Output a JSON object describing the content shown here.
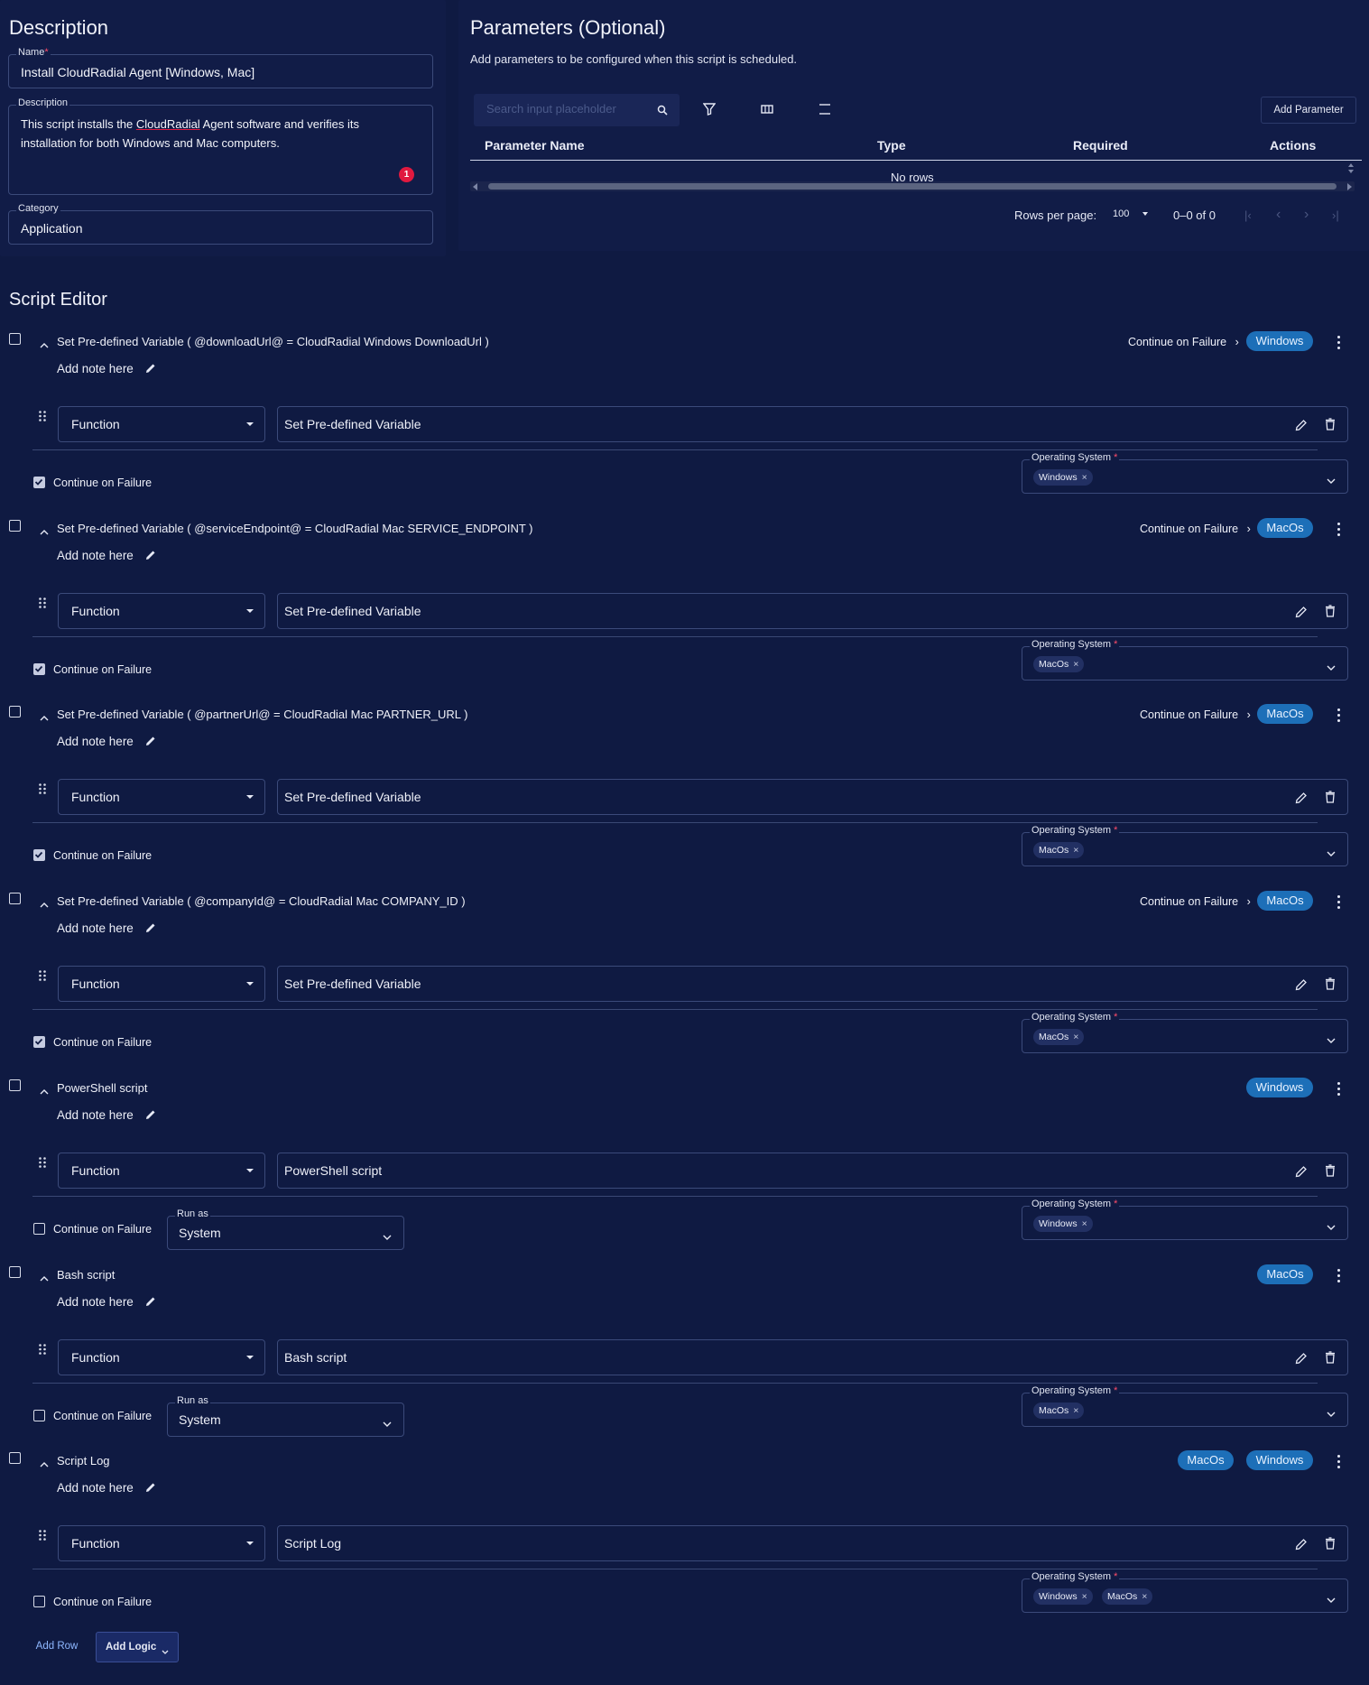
{
  "description_panel": {
    "title": "Description",
    "name_label": "Name",
    "name_value": "Install CloudRadial Agent [Windows, Mac]",
    "description_label": "Description",
    "description_value_pre": "This script installs the ",
    "description_value_link": "CloudRadial",
    "description_value_post": " Agent software and verifies its installation for both Windows and Mac computers.",
    "error_count": "1",
    "category_label": "Category",
    "category_value": "Application"
  },
  "parameters_panel": {
    "title": "Parameters (Optional)",
    "subtitle": "Add parameters to be configured when this script is scheduled.",
    "search_placeholder": "Search input placeholder",
    "add_parameter_label": "Add Parameter",
    "columns": [
      "Parameter Name",
      "Type",
      "Required",
      "Actions"
    ],
    "empty_text": "No rows",
    "rows_per_page_label": "Rows per page:",
    "rows_per_page_value": "100",
    "range_text": "0–0 of 0"
  },
  "script_editor": {
    "title": "Script Editor",
    "note_label": "Add note here",
    "function_label": "Function",
    "cof_label": "Continue on Failure",
    "os_label": "Operating System",
    "run_as_label": "Run as",
    "steps": [
      {
        "title": "Set Pre-defined Variable ( @downloadUrl@ = CloudRadial Windows DownloadUrl )",
        "header_cof": "Continue on Failure",
        "chips": [
          "Windows"
        ],
        "value": "Set Pre-defined Variable",
        "os": [
          "Windows"
        ],
        "cof_checked": true,
        "run_as": null
      },
      {
        "title": "Set Pre-defined Variable ( @serviceEndpoint@ = CloudRadial Mac SERVICE_ENDPOINT )",
        "header_cof": "Continue on Failure",
        "chips": [
          "MacOs"
        ],
        "value": "Set Pre-defined Variable",
        "os": [
          "MacOs"
        ],
        "cof_checked": true,
        "run_as": null
      },
      {
        "title": "Set Pre-defined Variable ( @partnerUrl@ = CloudRadial Mac PARTNER_URL )",
        "header_cof": "Continue on Failure",
        "chips": [
          "MacOs"
        ],
        "value": "Set Pre-defined Variable",
        "os": [
          "MacOs"
        ],
        "cof_checked": true,
        "run_as": null
      },
      {
        "title": "Set Pre-defined Variable ( @companyId@ = CloudRadial Mac COMPANY_ID )",
        "header_cof": "Continue on Failure",
        "chips": [
          "MacOs"
        ],
        "value": "Set Pre-defined Variable",
        "os": [
          "MacOs"
        ],
        "cof_checked": true,
        "run_as": null
      },
      {
        "title": "PowerShell script",
        "header_cof": "",
        "chips": [
          "Windows"
        ],
        "value": "PowerShell script",
        "os": [
          "Windows"
        ],
        "cof_checked": false,
        "run_as": "System"
      },
      {
        "title": "Bash script",
        "header_cof": "",
        "chips": [
          "MacOs"
        ],
        "value": "Bash script",
        "os": [
          "MacOs"
        ],
        "cof_checked": false,
        "run_as": "System"
      },
      {
        "title": "Script Log",
        "header_cof": "",
        "chips": [
          "MacOs",
          "Windows"
        ],
        "value": "Script Log",
        "os": [
          "Windows",
          "MacOs"
        ],
        "cof_checked": false,
        "run_as": null
      }
    ],
    "add_row_label": "Add Row",
    "add_logic_label": "Add Logic"
  },
  "colors": {
    "background": "#0f1a42",
    "panel": "#111c47",
    "chip_blue": "#1d6fb8",
    "error_badge": "#e0193f"
  }
}
